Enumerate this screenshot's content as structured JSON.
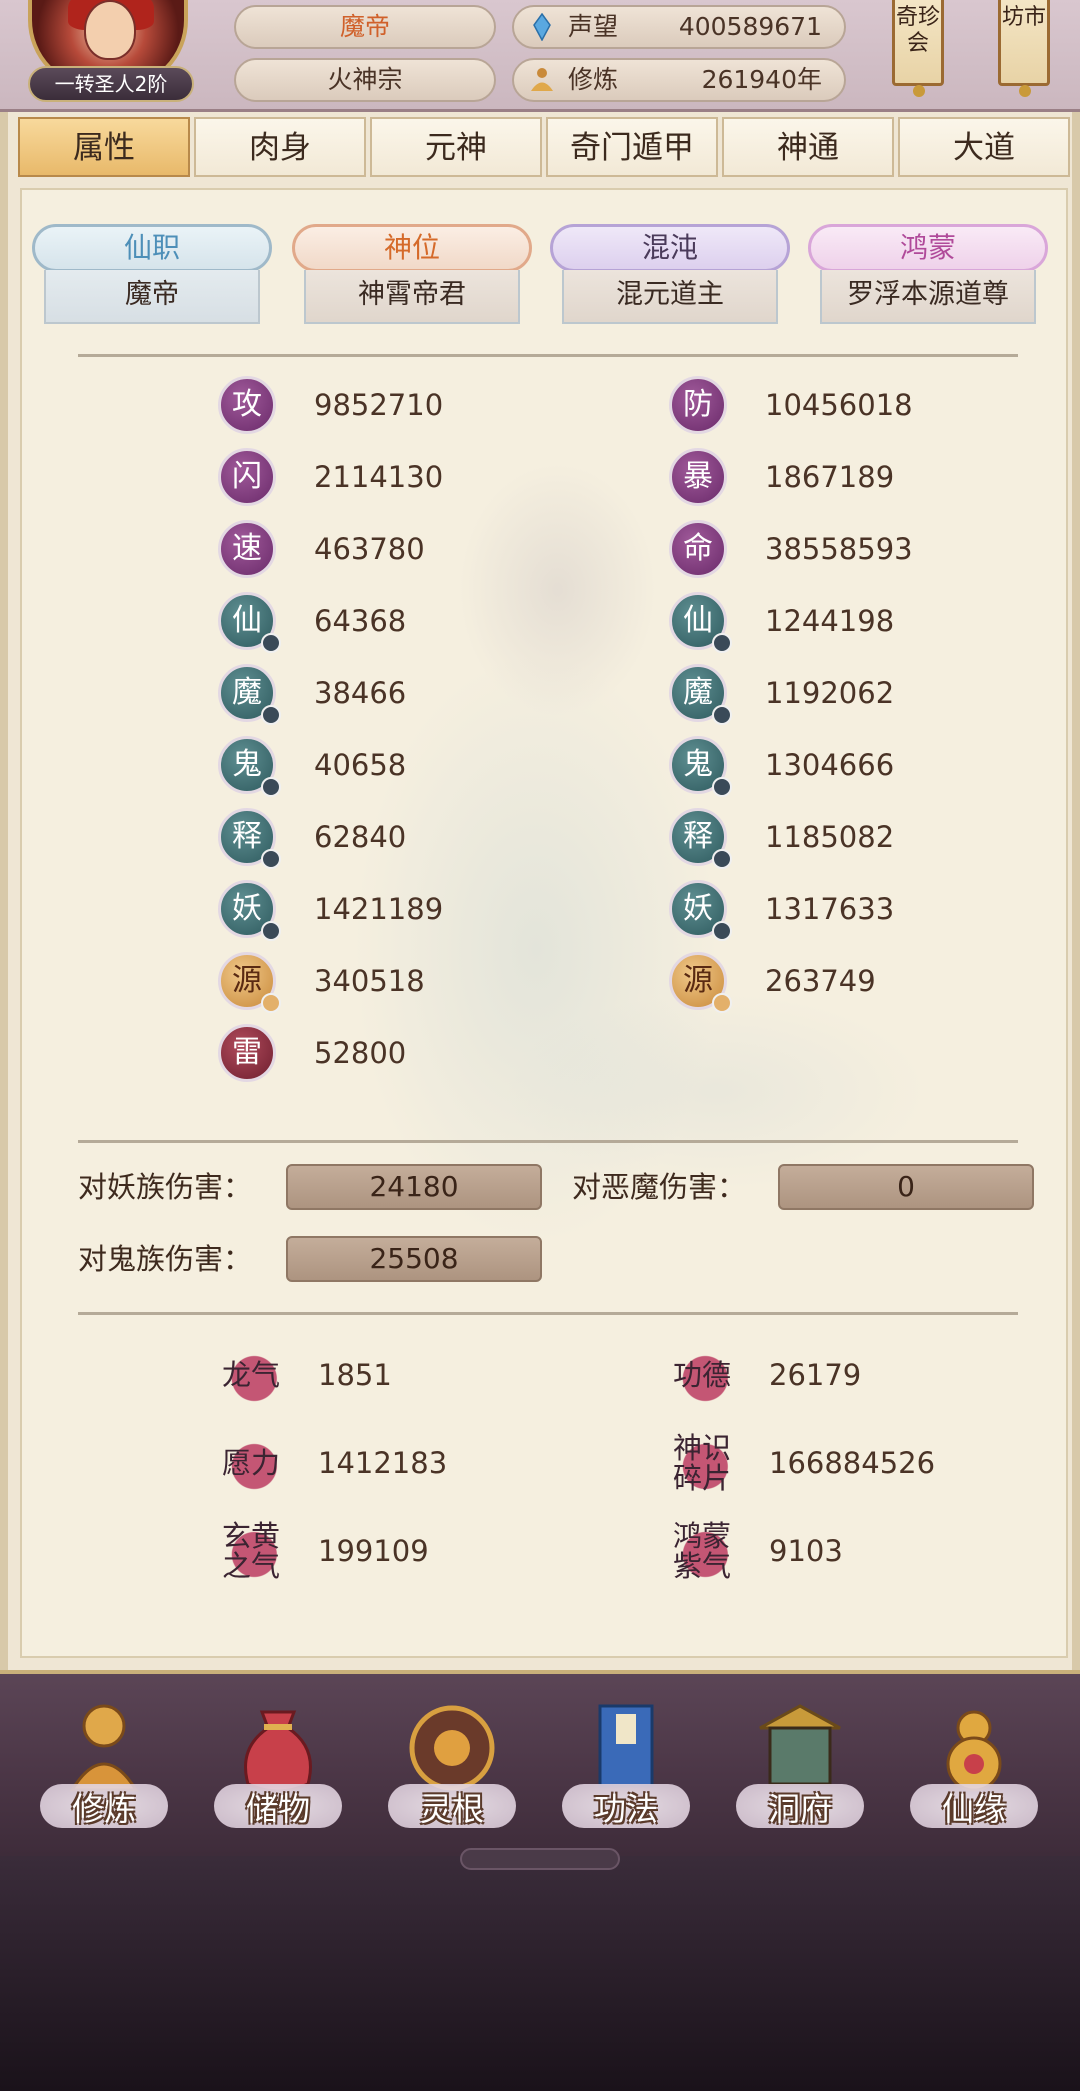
{
  "header": {
    "rank_badge": "一转圣人2阶",
    "char_name": "魔帝",
    "sect": "火神宗",
    "fame_label": "声望",
    "fame_value": "400589671",
    "cultivation_label": "修炼",
    "cultivation_value": "261940年",
    "scroll_buttons": [
      "奇珍会",
      "坊市"
    ]
  },
  "tabs": [
    "属性",
    "肉身",
    "元神",
    "奇门遁甲",
    "神通",
    "大道"
  ],
  "active_tab": "属性",
  "ranks": [
    {
      "title": "仙职",
      "value": "魔帝"
    },
    {
      "title": "神位",
      "value": "神霄帝君"
    },
    {
      "title": "混沌",
      "value": "混元道主"
    },
    {
      "title": "鸿蒙",
      "value": "罗浮本源道尊"
    }
  ],
  "stats_left": [
    {
      "glyph": "攻",
      "value": "9852710",
      "style": "purple"
    },
    {
      "glyph": "闪",
      "value": "2114130",
      "style": "purple"
    },
    {
      "glyph": "速",
      "value": "463780",
      "style": "purple"
    },
    {
      "glyph": "仙",
      "value": "64368",
      "style": "teal"
    },
    {
      "glyph": "魔",
      "value": "38466",
      "style": "teal"
    },
    {
      "glyph": "鬼",
      "value": "40658",
      "style": "teal"
    },
    {
      "glyph": "释",
      "value": "62840",
      "style": "teal"
    },
    {
      "glyph": "妖",
      "value": "1421189",
      "style": "teal"
    },
    {
      "glyph": "源",
      "value": "340518",
      "style": "gold"
    },
    {
      "glyph": "雷",
      "value": "52800",
      "style": "red"
    }
  ],
  "stats_right": [
    {
      "glyph": "防",
      "value": "10456018",
      "style": "purple"
    },
    {
      "glyph": "暴",
      "value": "1867189",
      "style": "purple"
    },
    {
      "glyph": "命",
      "value": "38558593",
      "style": "purple"
    },
    {
      "glyph": "仙",
      "value": "1244198",
      "style": "teal"
    },
    {
      "glyph": "魔",
      "value": "1192062",
      "style": "teal"
    },
    {
      "glyph": "鬼",
      "value": "1304666",
      "style": "teal"
    },
    {
      "glyph": "释",
      "value": "1185082",
      "style": "teal"
    },
    {
      "glyph": "妖",
      "value": "1317633",
      "style": "teal"
    },
    {
      "glyph": "源",
      "value": "263749",
      "style": "gold"
    }
  ],
  "damage": {
    "yao_label": "对妖族伤害：",
    "yao_value": "24180",
    "demon_label": "对恶魔伤害：",
    "demon_value": "0",
    "ghost_label": "对鬼族伤害：",
    "ghost_value": "25508"
  },
  "resources": {
    "dragon_qi": {
      "label": "龙气",
      "value": "1851"
    },
    "merit": {
      "label": "功德",
      "value": "26179"
    },
    "wish_power": {
      "label": "愿力",
      "value": "1412183"
    },
    "soul_shards": {
      "label_1": "神识",
      "label_2": "碎片",
      "value": "166884526"
    },
    "xuanhuang": {
      "label_1": "玄黄",
      "label_2": "之气",
      "value": "199109"
    },
    "hongmeng": {
      "label_1": "鸿蒙",
      "label_2": "紫气",
      "value": "9103"
    }
  },
  "bottom_nav": [
    "修炼",
    "储物",
    "灵根",
    "功法",
    "洞府",
    "仙缘"
  ]
}
